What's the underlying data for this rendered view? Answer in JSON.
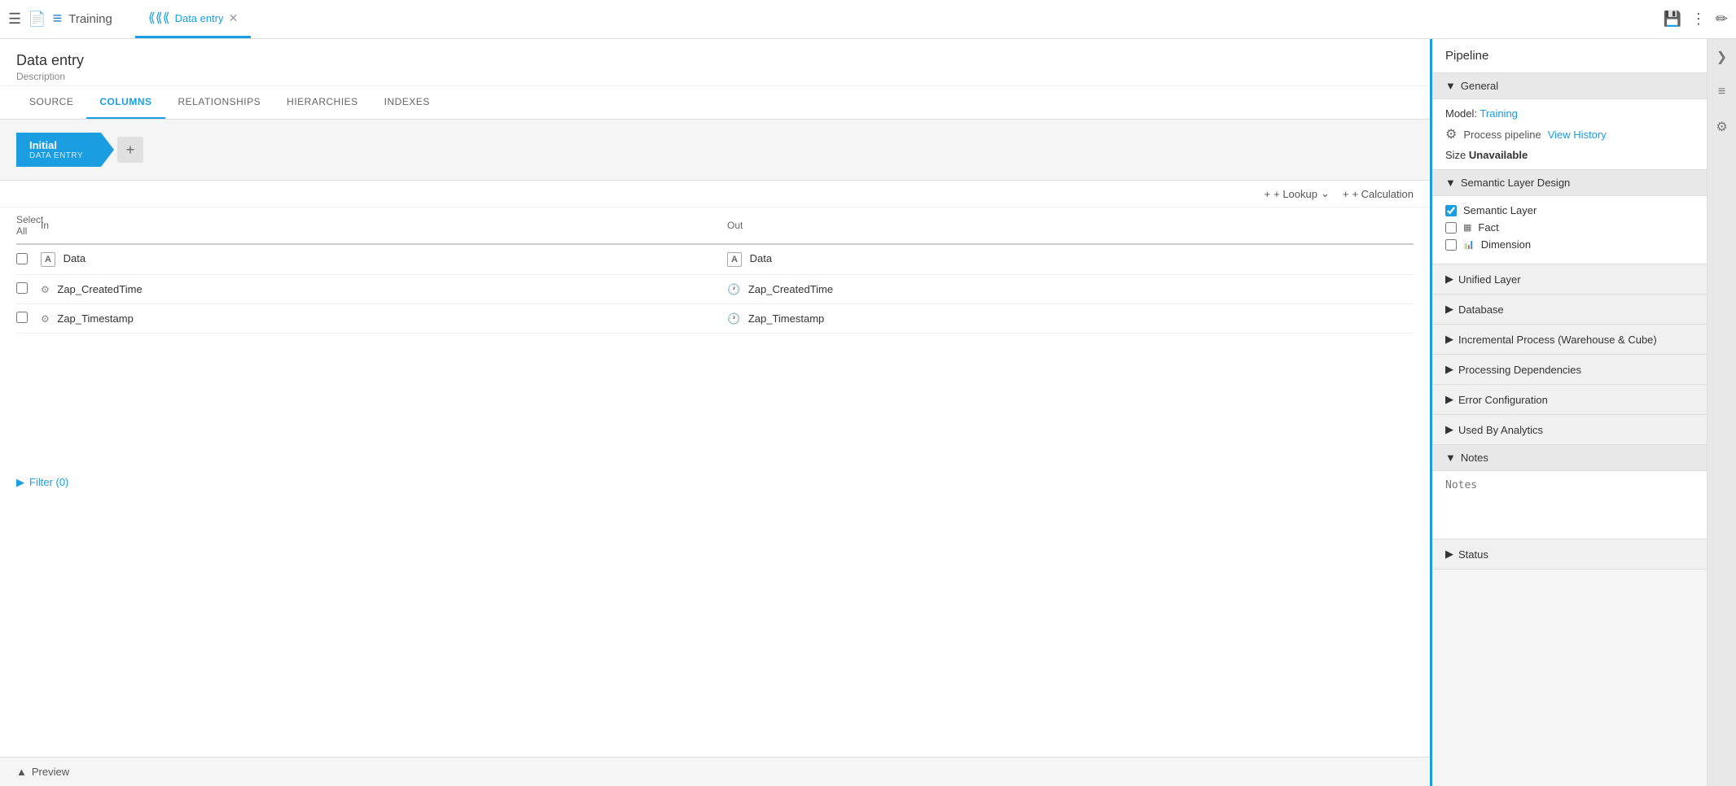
{
  "topbar": {
    "app_title": "Training",
    "tab_label": "Data entry",
    "tab_icon": "(((",
    "save_tooltip": "Save",
    "more_tooltip": "More",
    "edit_tooltip": "Edit"
  },
  "page": {
    "title": "Data entry",
    "description": "Description"
  },
  "nav_tabs": [
    {
      "id": "source",
      "label": "SOURCE",
      "active": false
    },
    {
      "id": "columns",
      "label": "COLUMNS",
      "active": true
    },
    {
      "id": "relationships",
      "label": "RELATIONSHIPS",
      "active": false
    },
    {
      "id": "hierarchies",
      "label": "HIERARCHIES",
      "active": false
    },
    {
      "id": "indexes",
      "label": "INDEXES",
      "active": false
    }
  ],
  "pipeline": {
    "step_title": "Initial",
    "step_subtitle": "DATA ENTRY",
    "add_label": "+"
  },
  "toolbar": {
    "lookup_label": "+ Lookup",
    "calculation_label": "+ Calculation"
  },
  "columns_header": {
    "select_all": "Select All",
    "in_label": "In",
    "out_label": "Out"
  },
  "columns": [
    {
      "id": "data",
      "in_icon": "A",
      "in_type": "text",
      "in_name": "Data",
      "out_icon": "A",
      "out_name": "Data"
    },
    {
      "id": "zap_created_time",
      "in_icon": "⚙",
      "in_type": "gear",
      "in_name": "Zap_CreatedTime",
      "out_icon": "🕐",
      "out_name": "Zap_CreatedTime"
    },
    {
      "id": "zap_timestamp",
      "in_icon": "⚙",
      "in_type": "gear",
      "in_name": "Zap_Timestamp",
      "out_icon": "🕐",
      "out_name": "Zap_Timestamp"
    }
  ],
  "filter": {
    "label": "Filter (0)"
  },
  "preview": {
    "label": "Preview"
  },
  "right_panel": {
    "title": "Pipeline",
    "general": {
      "header": "General",
      "model_label": "Model:",
      "model_name": "Training",
      "process_pipeline": "Process pipeline",
      "view_history": "View History",
      "size_label": "Size",
      "size_value": "Unavailable"
    },
    "semantic_layer": {
      "header": "Semantic Layer Design",
      "semantic_layer_label": "Semantic Layer",
      "semantic_layer_checked": true,
      "fact_label": "Fact",
      "fact_checked": false,
      "dimension_label": "Dimension",
      "dimension_checked": false
    },
    "collapsed_sections": [
      "Unified Layer",
      "Database",
      "Incremental Process (Warehouse & Cube)",
      "Processing Dependencies",
      "Error Configuration",
      "Used By Analytics"
    ],
    "notes": {
      "header": "Notes",
      "placeholder": "Notes"
    },
    "status": {
      "label": "Status"
    }
  }
}
